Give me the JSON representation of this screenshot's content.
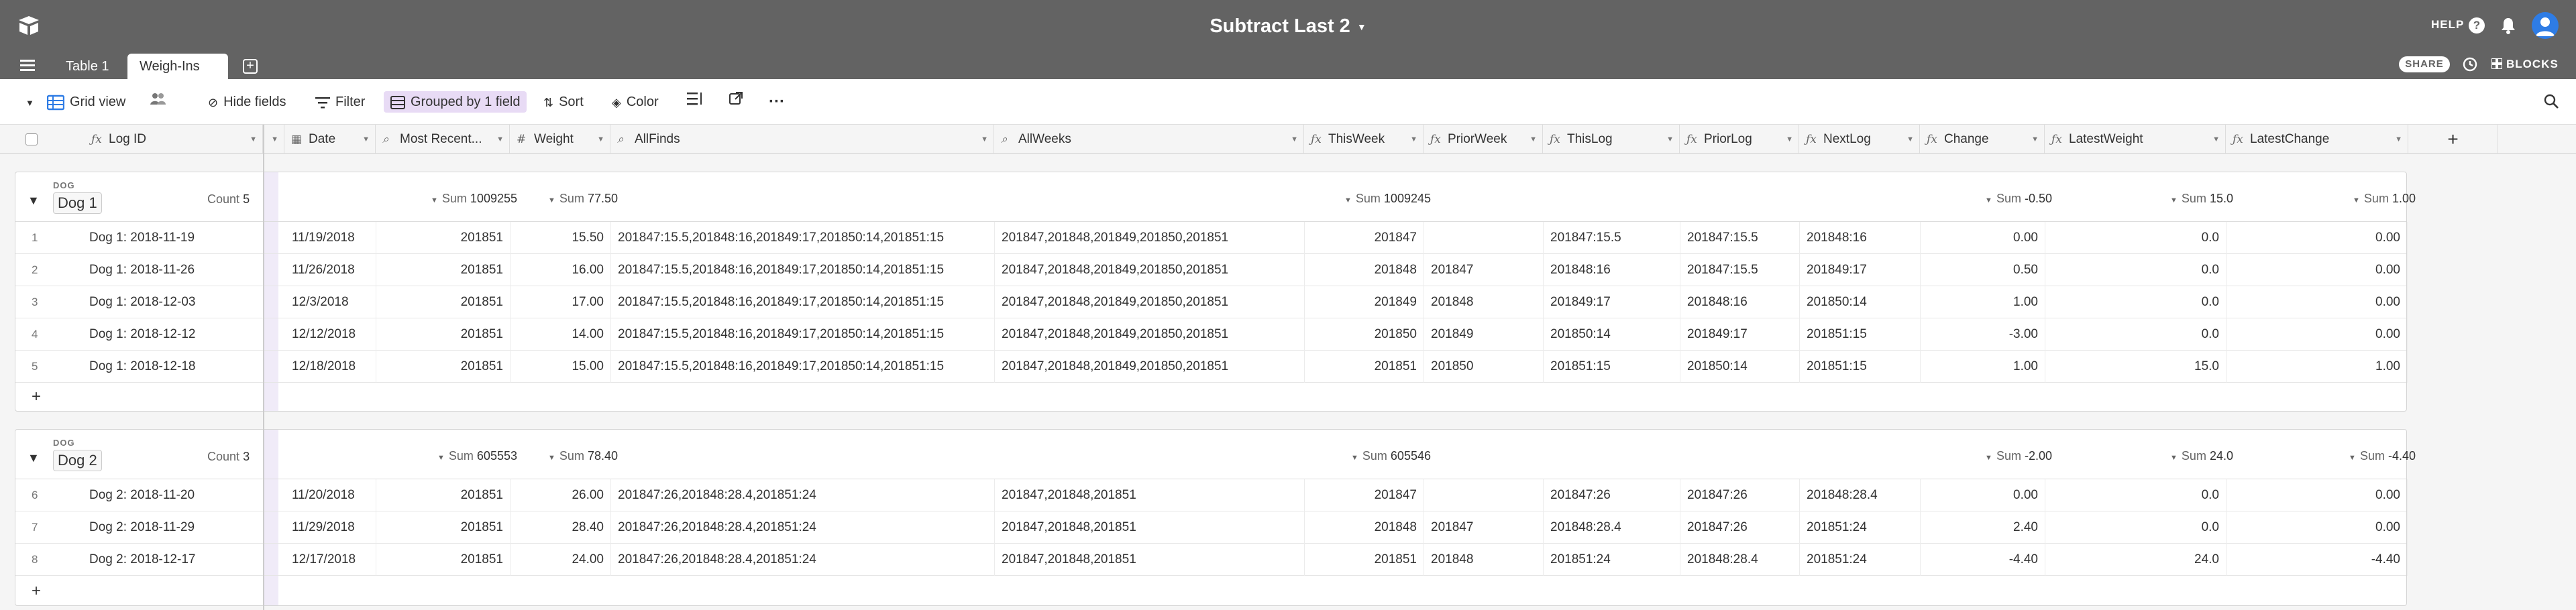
{
  "app": {
    "base_title": "Subtract Last 2",
    "help_label": "HELP",
    "share_label": "SHARE",
    "blocks_label": "BLOCKS",
    "tabs": [
      {
        "label": "Table 1",
        "active": false
      },
      {
        "label": "Weigh-Ins",
        "active": true
      }
    ],
    "colors": {
      "header": "#636363",
      "grouped": "#e8dbf5",
      "avatar": "#2e7ce5"
    }
  },
  "toolbar": {
    "view_label": "Grid view",
    "hide_fields": "Hide fields",
    "filter": "Filter",
    "grouped": "Grouped by 1 field",
    "sort": "Sort",
    "color": "Color"
  },
  "columns": [
    {
      "name": "Log ID",
      "icon": "formula-icon"
    },
    {
      "name": "Date",
      "icon": "calendar-icon"
    },
    {
      "name": "Most Recent...",
      "icon": "lookup-icon"
    },
    {
      "name": "Weight",
      "icon": "number-icon"
    },
    {
      "name": "AllFinds",
      "icon": "lookup-icon"
    },
    {
      "name": "AllWeeks",
      "icon": "lookup-icon"
    },
    {
      "name": "ThisWeek",
      "icon": "formula-icon"
    },
    {
      "name": "PriorWeek",
      "icon": "formula-icon"
    },
    {
      "name": "ThisLog",
      "icon": "formula-icon"
    },
    {
      "name": "PriorLog",
      "icon": "formula-icon"
    },
    {
      "name": "NextLog",
      "icon": "formula-icon"
    },
    {
      "name": "Change",
      "icon": "formula-icon"
    },
    {
      "name": "LatestWeight",
      "icon": "formula-icon"
    },
    {
      "name": "LatestChange",
      "icon": "formula-icon"
    }
  ],
  "groups": [
    {
      "label": "DOG",
      "name": "Dog 1",
      "count_label": "Count",
      "count": "5",
      "sums": {
        "most_recent": "1009255",
        "weight": "77.50",
        "thisweek": "1009245",
        "change": "-0.50",
        "latestweight": "15.0",
        "latestchange": "1.00"
      },
      "rows": [
        {
          "n": "1",
          "logid": "Dog 1: 2018-11-19",
          "date": "11/19/2018",
          "mr": "201851",
          "weight": "15.50",
          "allfinds": "201847:15.5,201848:16,201849:17,201850:14,201851:15",
          "allweeks": "201847,201848,201849,201850,201851",
          "thisweek": "201847",
          "priorweek": "",
          "thislog": "201847:15.5",
          "priorlog": "201847:15.5",
          "nextlog": "201848:16",
          "change": "0.00",
          "lw": "0.0",
          "lc": "0.00"
        },
        {
          "n": "2",
          "logid": "Dog 1: 2018-11-26",
          "date": "11/26/2018",
          "mr": "201851",
          "weight": "16.00",
          "allfinds": "201847:15.5,201848:16,201849:17,201850:14,201851:15",
          "allweeks": "201847,201848,201849,201850,201851",
          "thisweek": "201848",
          "priorweek": "201847",
          "thislog": "201848:16",
          "priorlog": "201847:15.5",
          "nextlog": "201849:17",
          "change": "0.50",
          "lw": "0.0",
          "lc": "0.00"
        },
        {
          "n": "3",
          "logid": "Dog 1: 2018-12-03",
          "date": "12/3/2018",
          "mr": "201851",
          "weight": "17.00",
          "allfinds": "201847:15.5,201848:16,201849:17,201850:14,201851:15",
          "allweeks": "201847,201848,201849,201850,201851",
          "thisweek": "201849",
          "priorweek": "201848",
          "thislog": "201849:17",
          "priorlog": "201848:16",
          "nextlog": "201850:14",
          "change": "1.00",
          "lw": "0.0",
          "lc": "0.00"
        },
        {
          "n": "4",
          "logid": "Dog 1: 2018-12-12",
          "date": "12/12/2018",
          "mr": "201851",
          "weight": "14.00",
          "allfinds": "201847:15.5,201848:16,201849:17,201850:14,201851:15",
          "allweeks": "201847,201848,201849,201850,201851",
          "thisweek": "201850",
          "priorweek": "201849",
          "thislog": "201850:14",
          "priorlog": "201849:17",
          "nextlog": "201851:15",
          "change": "-3.00",
          "lw": "0.0",
          "lc": "0.00"
        },
        {
          "n": "5",
          "logid": "Dog 1: 2018-12-18",
          "date": "12/18/2018",
          "mr": "201851",
          "weight": "15.00",
          "allfinds": "201847:15.5,201848:16,201849:17,201850:14,201851:15",
          "allweeks": "201847,201848,201849,201850,201851",
          "thisweek": "201851",
          "priorweek": "201850",
          "thislog": "201851:15",
          "priorlog": "201850:14",
          "nextlog": "201851:15",
          "change": "1.00",
          "lw": "15.0",
          "lc": "1.00"
        }
      ]
    },
    {
      "label": "DOG",
      "name": "Dog 2",
      "count_label": "Count",
      "count": "3",
      "sums": {
        "most_recent": "605553",
        "weight": "78.40",
        "thisweek": "605546",
        "change": "-2.00",
        "latestweight": "24.0",
        "latestchange": "-4.40"
      },
      "rows": [
        {
          "n": "6",
          "logid": "Dog 2: 2018-11-20",
          "date": "11/20/2018",
          "mr": "201851",
          "weight": "26.00",
          "allfinds": "201847:26,201848:28.4,201851:24",
          "allweeks": "201847,201848,201851",
          "thisweek": "201847",
          "priorweek": "",
          "thislog": "201847:26",
          "priorlog": "201847:26",
          "nextlog": "201848:28.4",
          "change": "0.00",
          "lw": "0.0",
          "lc": "0.00"
        },
        {
          "n": "7",
          "logid": "Dog 2: 2018-11-29",
          "date": "11/29/2018",
          "mr": "201851",
          "weight": "28.40",
          "allfinds": "201847:26,201848:28.4,201851:24",
          "allweeks": "201847,201848,201851",
          "thisweek": "201848",
          "priorweek": "201847",
          "thislog": "201848:28.4",
          "priorlog": "201847:26",
          "nextlog": "201851:24",
          "change": "2.40",
          "lw": "0.0",
          "lc": "0.00"
        },
        {
          "n": "8",
          "logid": "Dog 2: 2018-12-17",
          "date": "12/17/2018",
          "mr": "201851",
          "weight": "24.00",
          "allfinds": "201847:26,201848:28.4,201851:24",
          "allweeks": "201847,201848,201851",
          "thisweek": "201851",
          "priorweek": "201848",
          "thislog": "201851:24",
          "priorlog": "201848:28.4",
          "nextlog": "201851:24",
          "change": "-4.40",
          "lw": "24.0",
          "lc": "-4.40"
        }
      ]
    }
  ],
  "sum_label": "Sum"
}
